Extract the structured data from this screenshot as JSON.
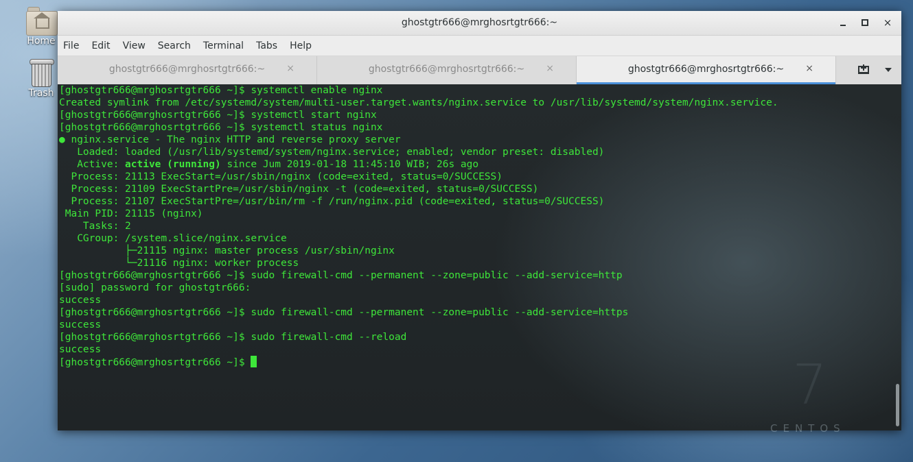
{
  "desktop": {
    "icons": [
      {
        "label": "Home",
        "icon": "home-folder-icon"
      },
      {
        "label": "Trash",
        "icon": "trash-icon"
      }
    ],
    "brand": {
      "version": "7",
      "name": "CENTOS"
    }
  },
  "window": {
    "title": "ghostgtr666@mrghosrtgtr666:~",
    "controls": {
      "minimize": "minimize-icon",
      "maximize": "maximize-icon",
      "close": "×"
    }
  },
  "menu": [
    "File",
    "Edit",
    "View",
    "Search",
    "Terminal",
    "Tabs",
    "Help"
  ],
  "tabs": [
    {
      "label": "ghostgtr666@mrghosrtgtr666:~",
      "close": "×",
      "active": false
    },
    {
      "label": "ghostgtr666@mrghosrtgtr666:~",
      "close": "×",
      "active": false
    },
    {
      "label": "ghostgtr666@mrghosrtgtr666:~",
      "close": "×",
      "active": true
    }
  ],
  "terminal": {
    "text_color": "#3ee63a",
    "lines": [
      "[ghostgtr666@mrghosrtgtr666 ~]$ systemctl enable nginx",
      "Created symlink from /etc/systemd/system/multi-user.target.wants/nginx.service to /usr/lib/systemd/system/nginx.service.",
      "[ghostgtr666@mrghosrtgtr666 ~]$ systemctl start nginx",
      "[ghostgtr666@mrghosrtgtr666 ~]$ systemctl status nginx",
      "● nginx.service - The nginx HTTP and reverse proxy server",
      "   Loaded: loaded (/usr/lib/systemd/system/nginx.service; enabled; vendor preset: disabled)",
      {
        "pre": "   Active: ",
        "bold": "active (running)",
        "post": " since Jum 2019-01-18 11:45:10 WIB; 26s ago"
      },
      "  Process: 21113 ExecStart=/usr/sbin/nginx (code=exited, status=0/SUCCESS)",
      "  Process: 21109 ExecStartPre=/usr/sbin/nginx -t (code=exited, status=0/SUCCESS)",
      "  Process: 21107 ExecStartPre=/usr/bin/rm -f /run/nginx.pid (code=exited, status=0/SUCCESS)",
      " Main PID: 21115 (nginx)",
      "    Tasks: 2",
      "   CGroup: /system.slice/nginx.service",
      "           ├─21115 nginx: master process /usr/sbin/nginx",
      "           └─21116 nginx: worker process",
      "[ghostgtr666@mrghosrtgtr666 ~]$ sudo firewall-cmd --permanent --zone=public --add-service=http",
      "[sudo] password for ghostgtr666:",
      "success",
      "[ghostgtr666@mrghosrtgtr666 ~]$ sudo firewall-cmd --permanent --zone=public --add-service=https",
      "success",
      "[ghostgtr666@mrghosrtgtr666 ~]$ sudo firewall-cmd --reload",
      "success"
    ],
    "prompt": "[ghostgtr666@mrghosrtgtr666 ~]$ "
  }
}
